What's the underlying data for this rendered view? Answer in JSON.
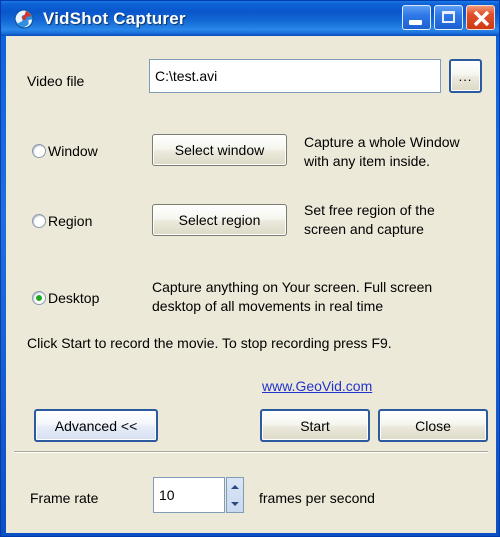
{
  "window": {
    "title": "VidShot Capturer",
    "icon": "globe-icon",
    "accent_color": "#0a56cc",
    "client_bg": "#ECE9D8",
    "buttons": {
      "minimize": "Minimize",
      "maximize": "Maximize",
      "close": "Close"
    }
  },
  "video_file": {
    "label": "Video file",
    "value": "C:\\test.avi",
    "placeholder": "",
    "browse_label": "..."
  },
  "modes": [
    {
      "id": "window",
      "label": "Window",
      "selected": false,
      "button_label": "Select window",
      "description_line1": "Capture a whole Window",
      "description_line2": "with any item inside."
    },
    {
      "id": "region",
      "label": "Region",
      "selected": false,
      "button_label": "Select region",
      "description_line1": "Set free region of the",
      "description_line2": "screen and capture"
    },
    {
      "id": "desktop",
      "label": "Desktop",
      "selected": true,
      "selected_color": "#1fa81f",
      "button_label": "",
      "description_line1": "Capture anything on Your screen. Full screen",
      "description_line2": "desktop of all movements in real time"
    }
  ],
  "instruction": "Click Start to record the movie. To stop recording press F9.",
  "link": {
    "text": "www.GeoVid.com",
    "color": "#2233cc"
  },
  "actions": {
    "advanced": "Advanced <<",
    "start": "Start",
    "close": "Close"
  },
  "frame_rate": {
    "label": "Frame rate",
    "value": "10",
    "unit_label": "frames per second"
  }
}
